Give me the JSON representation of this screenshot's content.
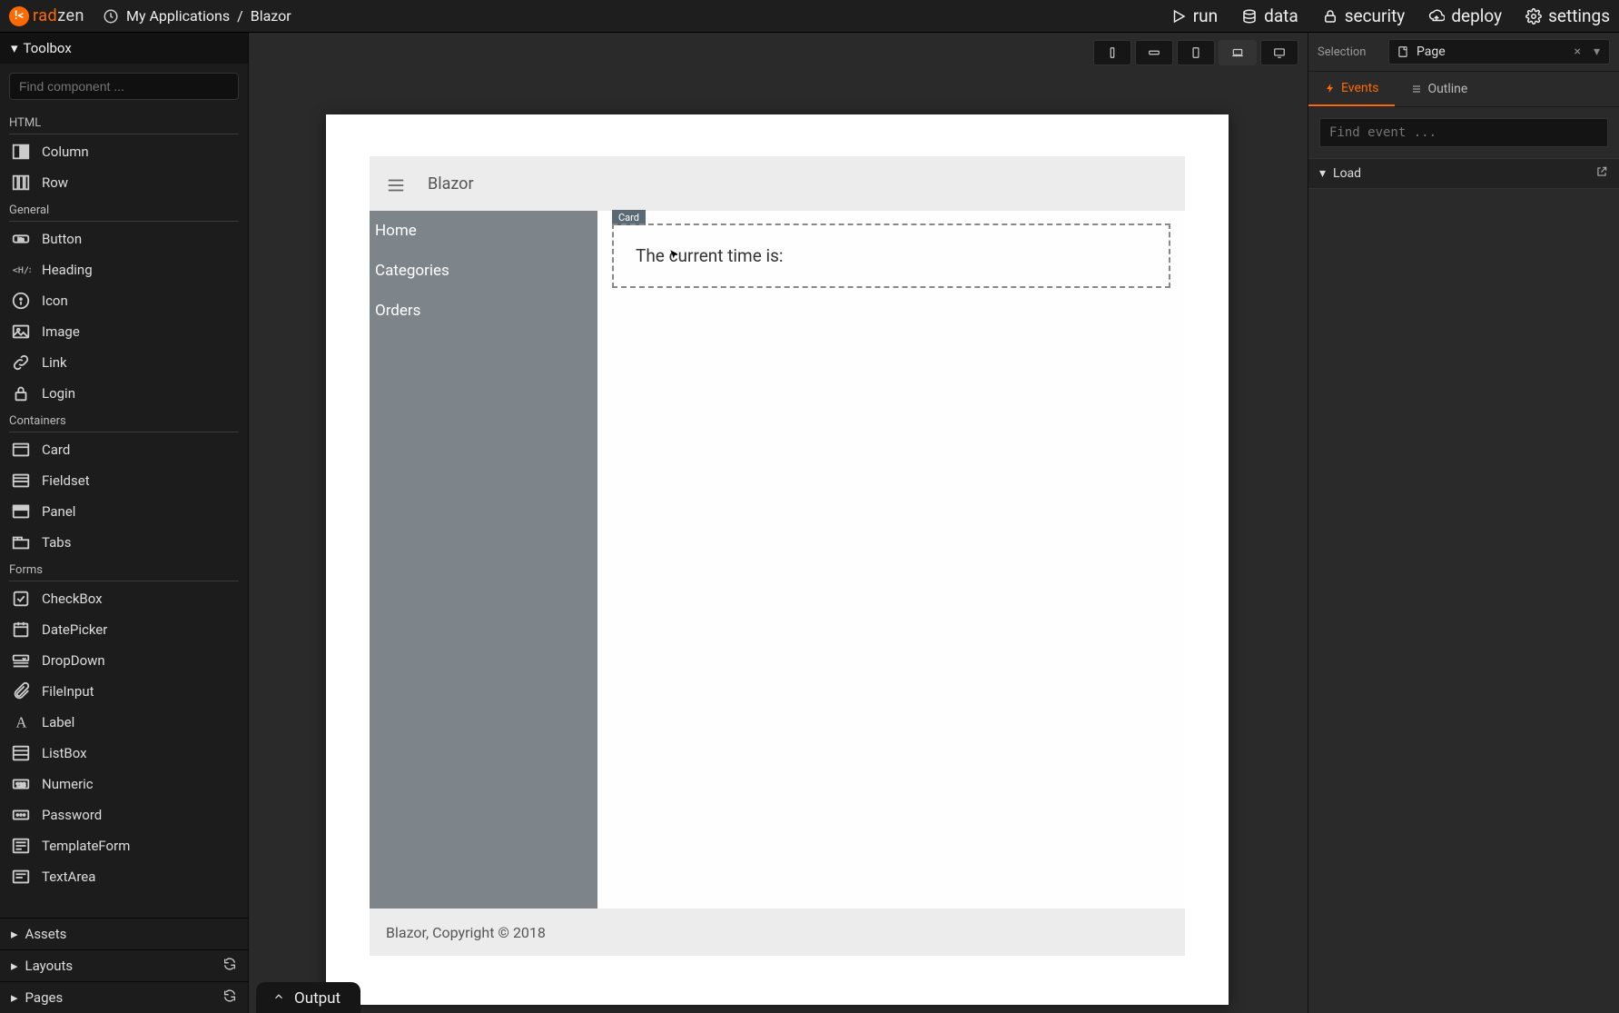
{
  "app": {
    "logo_rad": "rad",
    "logo_zen": "zen",
    "breadcrumb_root": "My Applications",
    "breadcrumb_sep": "/",
    "breadcrumb_current": "Blazor"
  },
  "topbar_actions": {
    "run": "run",
    "data": "data",
    "security": "security",
    "deploy": "deploy",
    "settings": "settings"
  },
  "toolbox": {
    "title": "Toolbox",
    "search_placeholder": "Find component ...",
    "groups": [
      {
        "name": "HTML",
        "items": [
          "Column",
          "Row"
        ]
      },
      {
        "name": "General",
        "items": [
          "Button",
          "Heading",
          "Icon",
          "Image",
          "Link",
          "Login"
        ]
      },
      {
        "name": "Containers",
        "items": [
          "Card",
          "Fieldset",
          "Panel",
          "Tabs"
        ]
      },
      {
        "name": "Forms",
        "items": [
          "CheckBox",
          "DatePicker",
          "DropDown",
          "FileInput",
          "Label",
          "ListBox",
          "Numeric",
          "Password",
          "TemplateForm",
          "TextArea"
        ]
      }
    ],
    "assets": "Assets",
    "layouts": "Layouts",
    "pages": "Pages"
  },
  "canvas": {
    "app_title": "Blazor",
    "nav_items": [
      "Home",
      "Categories",
      "Orders"
    ],
    "card_label": "Card",
    "card_text": "The current time is:",
    "footer": "Blazor, Copyright © 2018",
    "output": "Output"
  },
  "right": {
    "selection_label": "Selection",
    "selection_value": "Page",
    "tab_events": "Events",
    "tab_outline": "Outline",
    "event_search_placeholder": "Find event ...",
    "events": [
      "Load"
    ]
  }
}
